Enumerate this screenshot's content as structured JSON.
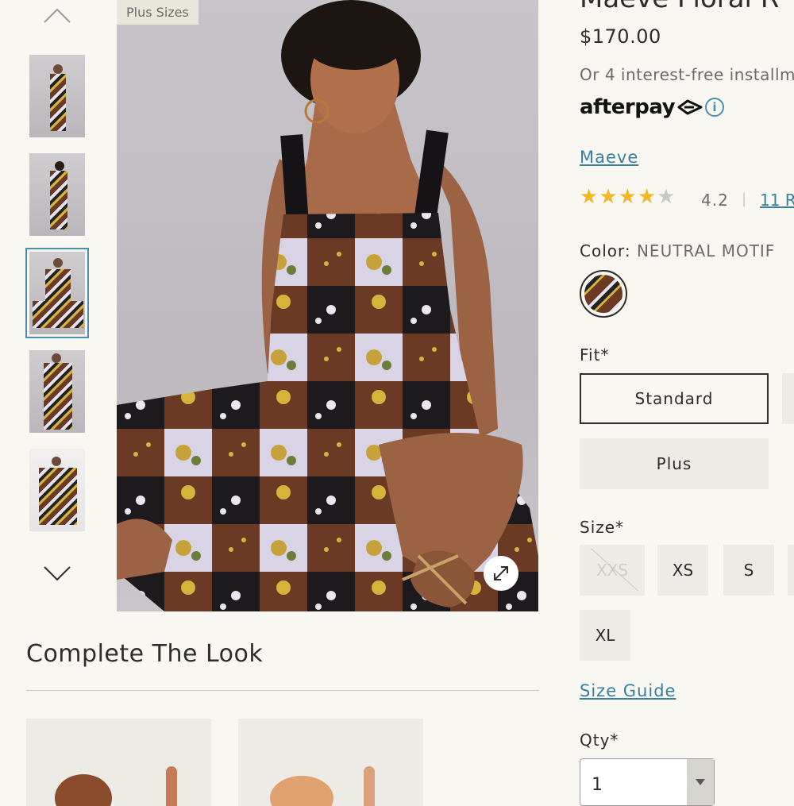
{
  "gallery": {
    "badge": "Plus Sizes",
    "thumbnails": [
      "thumb-1",
      "thumb-2",
      "thumb-3",
      "thumb-4",
      "thumb-5"
    ],
    "active_index": 2
  },
  "complete_look": {
    "title": "Complete The Look"
  },
  "product": {
    "title": "Maeve Floral R",
    "price": "$170.00",
    "installment_text": "Or 4 interest-free installm",
    "afterpay_label": "afterpay",
    "info_glyph": "i",
    "brand": "Maeve",
    "rating": {
      "value": "4.2",
      "stars_filled": 4,
      "stars_total": 5,
      "separator": "|",
      "reviews_text": "11 R"
    },
    "color": {
      "label": "Color:",
      "value": "NEUTRAL MOTIF"
    },
    "fit": {
      "label": "Fit*",
      "options": [
        "Standard",
        "Plus"
      ],
      "selected": "Standard"
    },
    "size": {
      "label": "Size*",
      "options": [
        "XXS",
        "XS",
        "S",
        "XL"
      ],
      "unavailable": [
        "XXS"
      ]
    },
    "size_guide": "Size Guide",
    "qty": {
      "label": "Qty*",
      "value": "1"
    }
  },
  "colors": {
    "link": "#3a7fa0",
    "star": "#f0b829",
    "accent_outline": "#4a8fb0",
    "background": "#f8f7f2"
  }
}
